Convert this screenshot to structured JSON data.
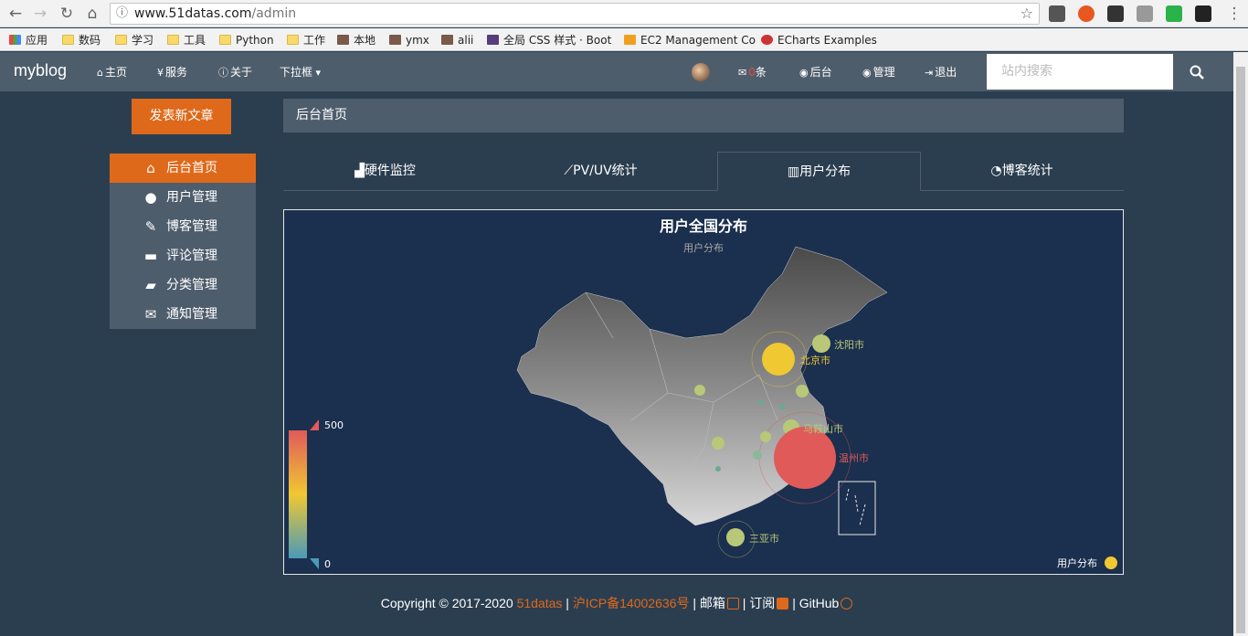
{
  "browser": {
    "url_host": "www.51datas.com",
    "url_path": "/admin",
    "bookmarks": [
      {
        "label": "应用",
        "icon": "apps-grid-icon"
      },
      {
        "label": "数码",
        "icon": "folder-icon"
      },
      {
        "label": "学习",
        "icon": "folder-icon"
      },
      {
        "label": "工具",
        "icon": "folder-icon"
      },
      {
        "label": "Python",
        "icon": "folder-icon"
      },
      {
        "label": "工作",
        "icon": "folder-icon"
      },
      {
        "label": "本地",
        "icon": "avatar-icon"
      },
      {
        "label": "ymx",
        "icon": "avatar-icon"
      },
      {
        "label": "alii",
        "icon": "avatar-icon"
      },
      {
        "label": "全局 CSS 样式 · Boot",
        "icon": "bootstrap-icon"
      },
      {
        "label": "EC2 Management Co",
        "icon": "box-icon"
      },
      {
        "label": "ECharts Examples",
        "icon": "echarts-icon"
      }
    ]
  },
  "navbar": {
    "brand": "myblog",
    "links": [
      {
        "label": "主页",
        "icon": "home-icon"
      },
      {
        "label": "服务",
        "icon": "cutlery-icon"
      },
      {
        "label": "关于",
        "icon": "info-icon"
      },
      {
        "label": "下拉框",
        "icon": "caret-down-icon"
      }
    ],
    "messages_count": "0",
    "messages_unit": "条",
    "backend": "后台",
    "manage": "管理",
    "logout": "退出",
    "search_placeholder": "站内搜索"
  },
  "sidebar": {
    "publish_label": "发表新文章",
    "items": [
      {
        "label": "后台首页",
        "icon": "home-icon",
        "active": true
      },
      {
        "label": "用户管理",
        "icon": "user-icon"
      },
      {
        "label": "博客管理",
        "icon": "pencil-icon"
      },
      {
        "label": "评论管理",
        "icon": "comment-icon"
      },
      {
        "label": "分类管理",
        "icon": "folder-open-icon"
      },
      {
        "label": "通知管理",
        "icon": "envelope-icon"
      }
    ]
  },
  "main": {
    "panel_title": "后台首页",
    "tabs": [
      {
        "label": "硬件监控",
        "icon": "area-chart-icon"
      },
      {
        "label": "PV/UV统计",
        "icon": "line-chart-icon"
      },
      {
        "label": "用户分布",
        "icon": "bar-chart-icon",
        "active": true
      },
      {
        "label": "博客统计",
        "icon": "pie-chart-icon"
      }
    ]
  },
  "chart_data": {
    "type": "scatter",
    "title": "用户全国分布",
    "subtitle": "用户分布",
    "legend": "用户分布",
    "legend_position": "bottom-right",
    "visual_map": {
      "min": 0,
      "max": 500
    },
    "labeled_points": [
      {
        "name": "北京市",
        "size": "large"
      },
      {
        "name": "沈阳市",
        "size": "small"
      },
      {
        "name": "马鞍山市",
        "size": "small"
      },
      {
        "name": "温州市",
        "size": "largest"
      },
      {
        "name": "三亚市",
        "size": "small"
      }
    ],
    "colors": {
      "high": "#e05a5a",
      "mid": "#f0c832",
      "low": "#b8c878",
      "min": "#4a9ab8"
    }
  },
  "footer": {
    "copyright": "Copyright © 2017-2020",
    "site": "51datas",
    "icp": "沪ICP备14002636号",
    "mail": "邮箱",
    "subscribe": "订阅",
    "github": "GitHub",
    "separator": "|"
  }
}
